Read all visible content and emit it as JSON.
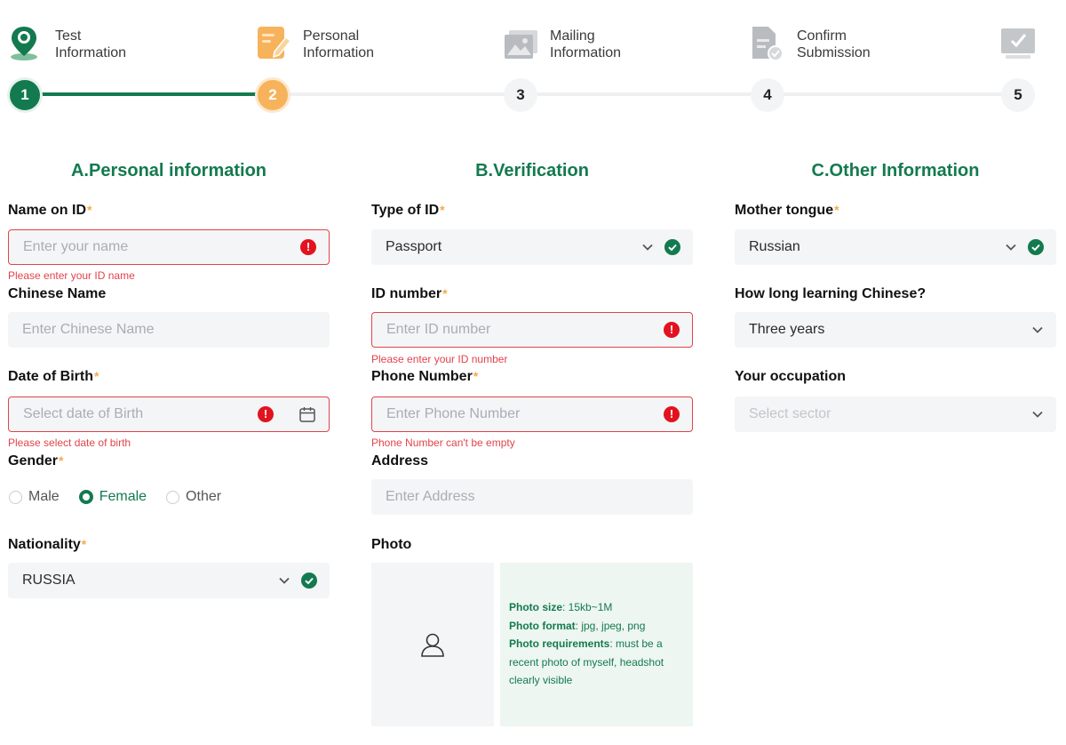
{
  "steps": [
    {
      "number": "1",
      "line1": "Test",
      "line2": "Information",
      "state": "done",
      "icon": "location-pin-icon"
    },
    {
      "number": "2",
      "line1": "Personal",
      "line2": "Information",
      "state": "active",
      "icon": "edit-document-icon"
    },
    {
      "number": "3",
      "line1": "Mailing",
      "line2": "Information",
      "state": "todo",
      "icon": "image-gallery-icon"
    },
    {
      "number": "4",
      "line1": "Confirm",
      "line2": "Submission",
      "state": "todo",
      "icon": "document-check-icon"
    },
    {
      "number": "5",
      "line1": "",
      "line2": "",
      "state": "todo",
      "icon": "monitor-check-icon"
    }
  ],
  "sections": {
    "a": "A.Personal information",
    "b": "B.Verification",
    "c": "C.Other Information"
  },
  "personal": {
    "name_label": "Name on ID",
    "name_placeholder": "Enter your name",
    "name_error": "Please enter your ID name",
    "chinese_label": "Chinese Name",
    "chinese_placeholder": "Enter Chinese Name",
    "dob_label": "Date of Birth",
    "dob_placeholder": "Select date of Birth",
    "dob_error": "Please select date of birth",
    "gender_label": "Gender",
    "gender_options": [
      "Male",
      "Female",
      "Other"
    ],
    "gender_selected": "Female",
    "nationality_label": "Nationality",
    "nationality_value": "RUSSIA"
  },
  "verification": {
    "idtype_label": "Type of ID",
    "idtype_value": "Passport",
    "idnum_label": "ID number",
    "idnum_placeholder": "Enter ID number",
    "idnum_error": "Please enter your ID number",
    "phone_label": "Phone Number",
    "phone_placeholder": "Enter Phone Number",
    "phone_error": "Phone Number can't be empty",
    "address_label": "Address",
    "address_placeholder": "Enter Address",
    "photo_label": "Photo",
    "photo_size_key": "Photo size",
    "photo_size_val": ": 15kb~1M",
    "photo_format_key": "Photo format",
    "photo_format_val": ": jpg, jpeg, png",
    "photo_req_key": "Photo requirements",
    "photo_req_val": ": must be a recent photo of myself, headshot clearly visible"
  },
  "other": {
    "tongue_label": "Mother tongue",
    "tongue_value": "Russian",
    "learning_label": "How long learning Chinese?",
    "learning_value": "Three years",
    "occupation_label": "Your occupation",
    "occupation_placeholder": "Select sector"
  },
  "required_mark": "*",
  "error_mark": "!",
  "colors": {
    "brand": "#137a4f",
    "accent": "#f7b35b",
    "error": "#e2434b",
    "required": "#f5a94a"
  }
}
